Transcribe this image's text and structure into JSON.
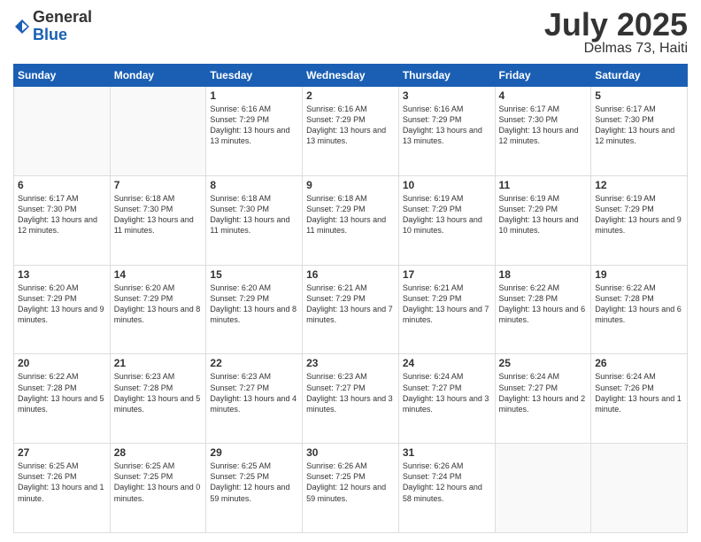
{
  "header": {
    "logo_general": "General",
    "logo_blue": "Blue",
    "month_title": "July 2025",
    "location": "Delmas 73, Haiti"
  },
  "weekdays": [
    "Sunday",
    "Monday",
    "Tuesday",
    "Wednesday",
    "Thursday",
    "Friday",
    "Saturday"
  ],
  "weeks": [
    [
      {
        "day": "",
        "info": ""
      },
      {
        "day": "",
        "info": ""
      },
      {
        "day": "1",
        "info": "Sunrise: 6:16 AM\nSunset: 7:29 PM\nDaylight: 13 hours\nand 13 minutes."
      },
      {
        "day": "2",
        "info": "Sunrise: 6:16 AM\nSunset: 7:29 PM\nDaylight: 13 hours\nand 13 minutes."
      },
      {
        "day": "3",
        "info": "Sunrise: 6:16 AM\nSunset: 7:29 PM\nDaylight: 13 hours\nand 13 minutes."
      },
      {
        "day": "4",
        "info": "Sunrise: 6:17 AM\nSunset: 7:30 PM\nDaylight: 13 hours\nand 12 minutes."
      },
      {
        "day": "5",
        "info": "Sunrise: 6:17 AM\nSunset: 7:30 PM\nDaylight: 13 hours\nand 12 minutes."
      }
    ],
    [
      {
        "day": "6",
        "info": "Sunrise: 6:17 AM\nSunset: 7:30 PM\nDaylight: 13 hours\nand 12 minutes."
      },
      {
        "day": "7",
        "info": "Sunrise: 6:18 AM\nSunset: 7:30 PM\nDaylight: 13 hours\nand 11 minutes."
      },
      {
        "day": "8",
        "info": "Sunrise: 6:18 AM\nSunset: 7:30 PM\nDaylight: 13 hours\nand 11 minutes."
      },
      {
        "day": "9",
        "info": "Sunrise: 6:18 AM\nSunset: 7:29 PM\nDaylight: 13 hours\nand 11 minutes."
      },
      {
        "day": "10",
        "info": "Sunrise: 6:19 AM\nSunset: 7:29 PM\nDaylight: 13 hours\nand 10 minutes."
      },
      {
        "day": "11",
        "info": "Sunrise: 6:19 AM\nSunset: 7:29 PM\nDaylight: 13 hours\nand 10 minutes."
      },
      {
        "day": "12",
        "info": "Sunrise: 6:19 AM\nSunset: 7:29 PM\nDaylight: 13 hours\nand 9 minutes."
      }
    ],
    [
      {
        "day": "13",
        "info": "Sunrise: 6:20 AM\nSunset: 7:29 PM\nDaylight: 13 hours\nand 9 minutes."
      },
      {
        "day": "14",
        "info": "Sunrise: 6:20 AM\nSunset: 7:29 PM\nDaylight: 13 hours\nand 8 minutes."
      },
      {
        "day": "15",
        "info": "Sunrise: 6:20 AM\nSunset: 7:29 PM\nDaylight: 13 hours\nand 8 minutes."
      },
      {
        "day": "16",
        "info": "Sunrise: 6:21 AM\nSunset: 7:29 PM\nDaylight: 13 hours\nand 7 minutes."
      },
      {
        "day": "17",
        "info": "Sunrise: 6:21 AM\nSunset: 7:29 PM\nDaylight: 13 hours\nand 7 minutes."
      },
      {
        "day": "18",
        "info": "Sunrise: 6:22 AM\nSunset: 7:28 PM\nDaylight: 13 hours\nand 6 minutes."
      },
      {
        "day": "19",
        "info": "Sunrise: 6:22 AM\nSunset: 7:28 PM\nDaylight: 13 hours\nand 6 minutes."
      }
    ],
    [
      {
        "day": "20",
        "info": "Sunrise: 6:22 AM\nSunset: 7:28 PM\nDaylight: 13 hours\nand 5 minutes."
      },
      {
        "day": "21",
        "info": "Sunrise: 6:23 AM\nSunset: 7:28 PM\nDaylight: 13 hours\nand 5 minutes."
      },
      {
        "day": "22",
        "info": "Sunrise: 6:23 AM\nSunset: 7:27 PM\nDaylight: 13 hours\nand 4 minutes."
      },
      {
        "day": "23",
        "info": "Sunrise: 6:23 AM\nSunset: 7:27 PM\nDaylight: 13 hours\nand 3 minutes."
      },
      {
        "day": "24",
        "info": "Sunrise: 6:24 AM\nSunset: 7:27 PM\nDaylight: 13 hours\nand 3 minutes."
      },
      {
        "day": "25",
        "info": "Sunrise: 6:24 AM\nSunset: 7:27 PM\nDaylight: 13 hours\nand 2 minutes."
      },
      {
        "day": "26",
        "info": "Sunrise: 6:24 AM\nSunset: 7:26 PM\nDaylight: 13 hours\nand 1 minute."
      }
    ],
    [
      {
        "day": "27",
        "info": "Sunrise: 6:25 AM\nSunset: 7:26 PM\nDaylight: 13 hours\nand 1 minute."
      },
      {
        "day": "28",
        "info": "Sunrise: 6:25 AM\nSunset: 7:25 PM\nDaylight: 13 hours\nand 0 minutes."
      },
      {
        "day": "29",
        "info": "Sunrise: 6:25 AM\nSunset: 7:25 PM\nDaylight: 12 hours\nand 59 minutes."
      },
      {
        "day": "30",
        "info": "Sunrise: 6:26 AM\nSunset: 7:25 PM\nDaylight: 12 hours\nand 59 minutes."
      },
      {
        "day": "31",
        "info": "Sunrise: 6:26 AM\nSunset: 7:24 PM\nDaylight: 12 hours\nand 58 minutes."
      },
      {
        "day": "",
        "info": ""
      },
      {
        "day": "",
        "info": ""
      }
    ]
  ]
}
